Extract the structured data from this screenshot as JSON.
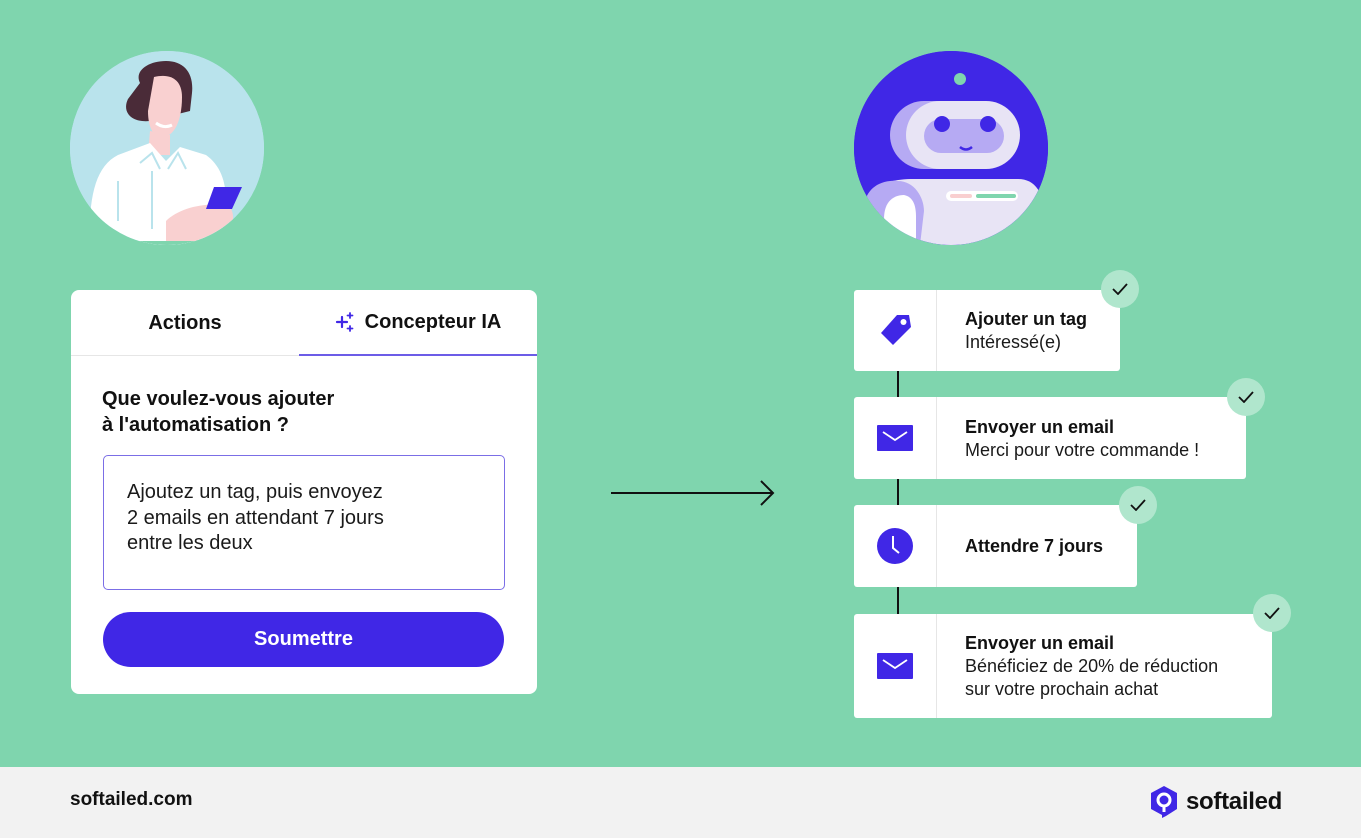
{
  "tabs": {
    "actions": "Actions",
    "ai_designer": "Concepteur IA"
  },
  "form": {
    "question_line1": "Que voulez-vous ajouter",
    "question_line2": "à l'automatisation ?",
    "prompt_value": "Ajoutez un tag, puis envoyez\n2 emails en attendant 7 jours\nentre les deux",
    "submit_label": "Soumettre"
  },
  "steps": [
    {
      "icon": "tag-icon",
      "title": "Ajouter un tag",
      "subtitle": "Intéressé(e)",
      "completed": true
    },
    {
      "icon": "mail-icon",
      "title": "Envoyer un email",
      "subtitle": "Merci pour votre commande !",
      "completed": true
    },
    {
      "icon": "clock-icon",
      "title": "Attendre 7 jours",
      "subtitle": "",
      "completed": true
    },
    {
      "icon": "mail-icon",
      "title": "Envoyer un email",
      "subtitle": "Bénéficiez de 20% de réduction\nsur votre prochain achat",
      "completed": true
    }
  ],
  "footer": {
    "url": "softailed.com",
    "brand": "softailed"
  },
  "colors": {
    "background": "#7fd5ae",
    "accent": "#4027e6",
    "check_badge": "#b0e6cd",
    "footer_bg": "#f2f2f2"
  }
}
